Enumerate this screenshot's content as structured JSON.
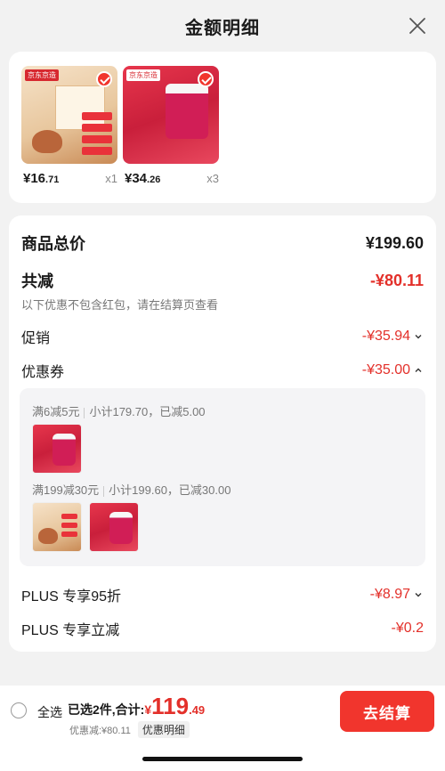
{
  "header": {
    "title": "金额明细"
  },
  "products": [
    {
      "price_int": "¥16",
      "price_dec": ".71",
      "qty": "x1",
      "badge": "京东京造"
    },
    {
      "price_int": "¥34",
      "price_dec": ".26",
      "qty": "x3",
      "badge": "京东京造"
    }
  ],
  "summary": {
    "total_label": "商品总价",
    "total_value": "¥199.60",
    "reduce_label": "共减",
    "reduce_value": "-¥80.11",
    "note": "以下优惠不包含红包，请在结算页查看",
    "promo_label": "促销",
    "promo_value": "-¥35.94",
    "coupon_label": "优惠券",
    "coupon_value": "-¥35.00",
    "plus_discount_label": "PLUS 专享95折",
    "plus_discount_value": "-¥8.97",
    "plus_reduce_label": "PLUS 专享立减",
    "plus_reduce_value": "-¥0.2"
  },
  "coupons": [
    {
      "rule": "满6减5元",
      "detail": "小计179.70，已减5.00"
    },
    {
      "rule": "满199减30元",
      "detail": "小计199.60，已减30.00"
    }
  ],
  "bottom": {
    "select_all": "全选",
    "selected_text": "已选2件,合计:",
    "currency": "¥",
    "total_int": "119",
    "total_dec": ".49",
    "discount_text": "优惠减:¥80.11",
    "detail_button": "优惠明细",
    "checkout_button": "去结算"
  },
  "colors": {
    "accent": "#f1352d",
    "price_red": "#e3302a"
  }
}
